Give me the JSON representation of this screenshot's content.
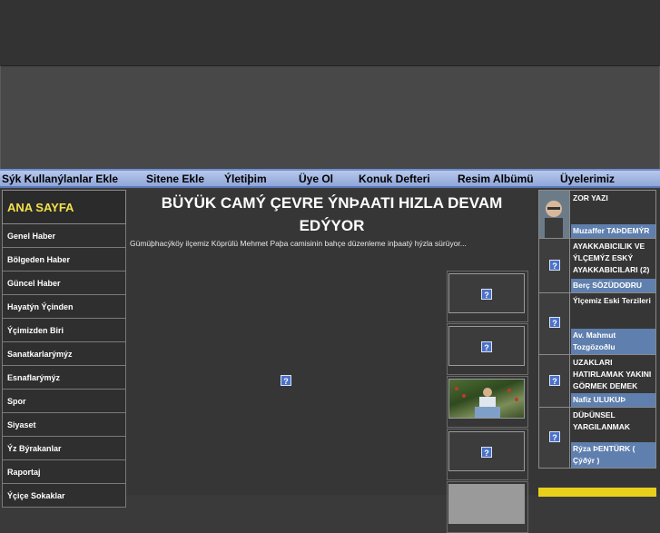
{
  "nav": {
    "items": [
      "Sýk Kullanýlanlar Ekle",
      "Sitene Ekle",
      "Ýletiþim",
      "Üye Ol",
      "Konuk Defteri",
      "Resim Albümü",
      "Üyelerimiz"
    ]
  },
  "sidebar": {
    "home": "ANA SAYFA",
    "items": [
      "Genel Haber",
      "Bölgeden Haber",
      "Güncel Haber",
      "Hayatýn Ýçinden",
      "Ýçimizden Biri",
      "Sanatkarlarýmýz",
      "Esnaflarýmýz",
      "Spor",
      "Siyaset",
      "Ýz Býrakanlar",
      "Raportaj",
      "Ýçiçe Sokaklar"
    ]
  },
  "article": {
    "headline": "BÜYÜK CAMÝ ÇEVRE ÝNÞAATI HIZLA DEVAM EDÝYOR",
    "summary": "Gümüþhacýköy ilçemiz Köprülü Mehmet Paþa camisinin bahçe düzenleme inþaatý hýzla sürüyor..."
  },
  "icons": {
    "missing_image": "?"
  },
  "authors": [
    {
      "title": "ZOR YAZI",
      "name": "Muzaffer TAÞDEMÝR"
    },
    {
      "title": "AYAKKABICILIK VE ÝLÇEMÝZ ESKÝ AYAKKABICILARI (2)",
      "name": "Berç SÖZÜDOÐRU"
    },
    {
      "title": "Ýlçemiz Eski Terzileri",
      "name": "Av. Mahmut Tozgözoðlu"
    },
    {
      "title": "UZAKLARI HATIRLAMAK YAKINI GÖRMEK DEMEK",
      "name": "Nafiz ULUKUÞ"
    },
    {
      "title": "DÜÞÜNSEL YARGILANMAK",
      "name": "Rýza ÞENTÜRK ( Çýðýr )"
    }
  ],
  "colors": {
    "accent_nav": "#8fa6d8",
    "sidebar_home": "#f2e14a",
    "author_name_bg": "#5f7fae"
  }
}
